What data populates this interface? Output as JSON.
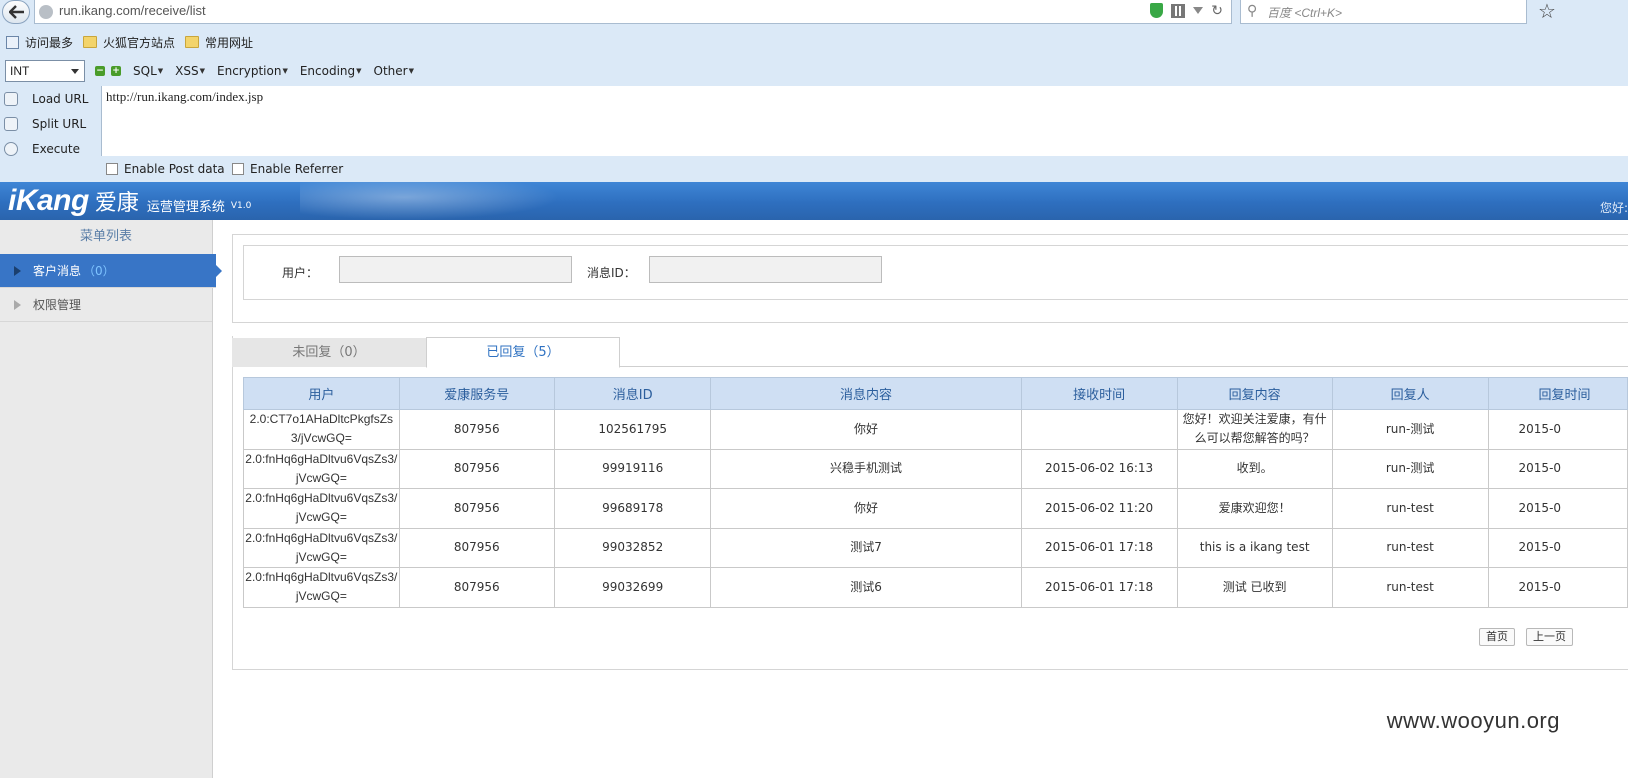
{
  "browser": {
    "url": "run.ikang.com/receive/list",
    "search_placeholder": "百度 <Ctrl+K>",
    "bookmarks": [
      "访问最多",
      "火狐官方站点",
      "常用网址"
    ]
  },
  "hackbar": {
    "int_value": "INT",
    "menus": [
      "SQL",
      "XSS",
      "Encryption",
      "Encoding",
      "Other"
    ],
    "load_url": "Load URL",
    "split_url": "Split URL",
    "execute": "Execute",
    "url_value": "http://run.ikang.com/index.jsp",
    "enable_post": "Enable Post data",
    "enable_referrer": "Enable Referrer"
  },
  "app": {
    "logo_en": "iKang",
    "logo_cn": "爱康",
    "subtitle": "运营管理系统",
    "version": "V1.0",
    "greeting": "您好:"
  },
  "sidebar": {
    "title": "菜单列表",
    "items": [
      {
        "label": "客户消息",
        "count": "（0）"
      },
      {
        "label": "权限管理",
        "count": ""
      }
    ]
  },
  "search": {
    "user_label": "用户：",
    "msgid_label": "消息ID："
  },
  "tabs": {
    "unreplied": "未回复（0）",
    "replied": "已回复（5）"
  },
  "table": {
    "headers": [
      "用户",
      "爱康服务号",
      "消息ID",
      "消息内容",
      "接收时间",
      "回复内容",
      "回复人",
      "回复时间"
    ],
    "rows": [
      [
        "2.0:CT7o1AHaDltcPkgfsZs3/jVcwGQ=",
        "807956",
        "102561795",
        "你好",
        "",
        "您好！欢迎关注爱康，有什么可以帮您解答的吗？",
        "run-测试",
        "2015-0"
      ],
      [
        "2.0:fnHq6gHaDltvu6VqsZs3/jVcwGQ=",
        "807956",
        "99919116",
        "兴稳手机测试",
        "2015-06-02 16:13",
        "收到。",
        "run-测试",
        "2015-0"
      ],
      [
        "2.0:fnHq6gHaDltvu6VqsZs3/jVcwGQ=",
        "807956",
        "99689178",
        "你好",
        "2015-06-02 11:20",
        "爱康欢迎您！",
        "run-test",
        "2015-0"
      ],
      [
        "2.0:fnHq6gHaDltvu6VqsZs3/jVcwGQ=",
        "807956",
        "99032852",
        "测试7",
        "2015-06-01 17:18",
        "this is a ikang test",
        "run-test",
        "2015-0"
      ],
      [
        "2.0:fnHq6gHaDltvu6VqsZs3/jVcwGQ=",
        "807956",
        "99032699",
        "测试6",
        "2015-06-01 17:18",
        "测试 已收到",
        "run-test",
        "2015-0"
      ]
    ]
  },
  "pager": {
    "first": "首页",
    "prev": "上一页"
  },
  "watermark": "www.wooyun.org"
}
